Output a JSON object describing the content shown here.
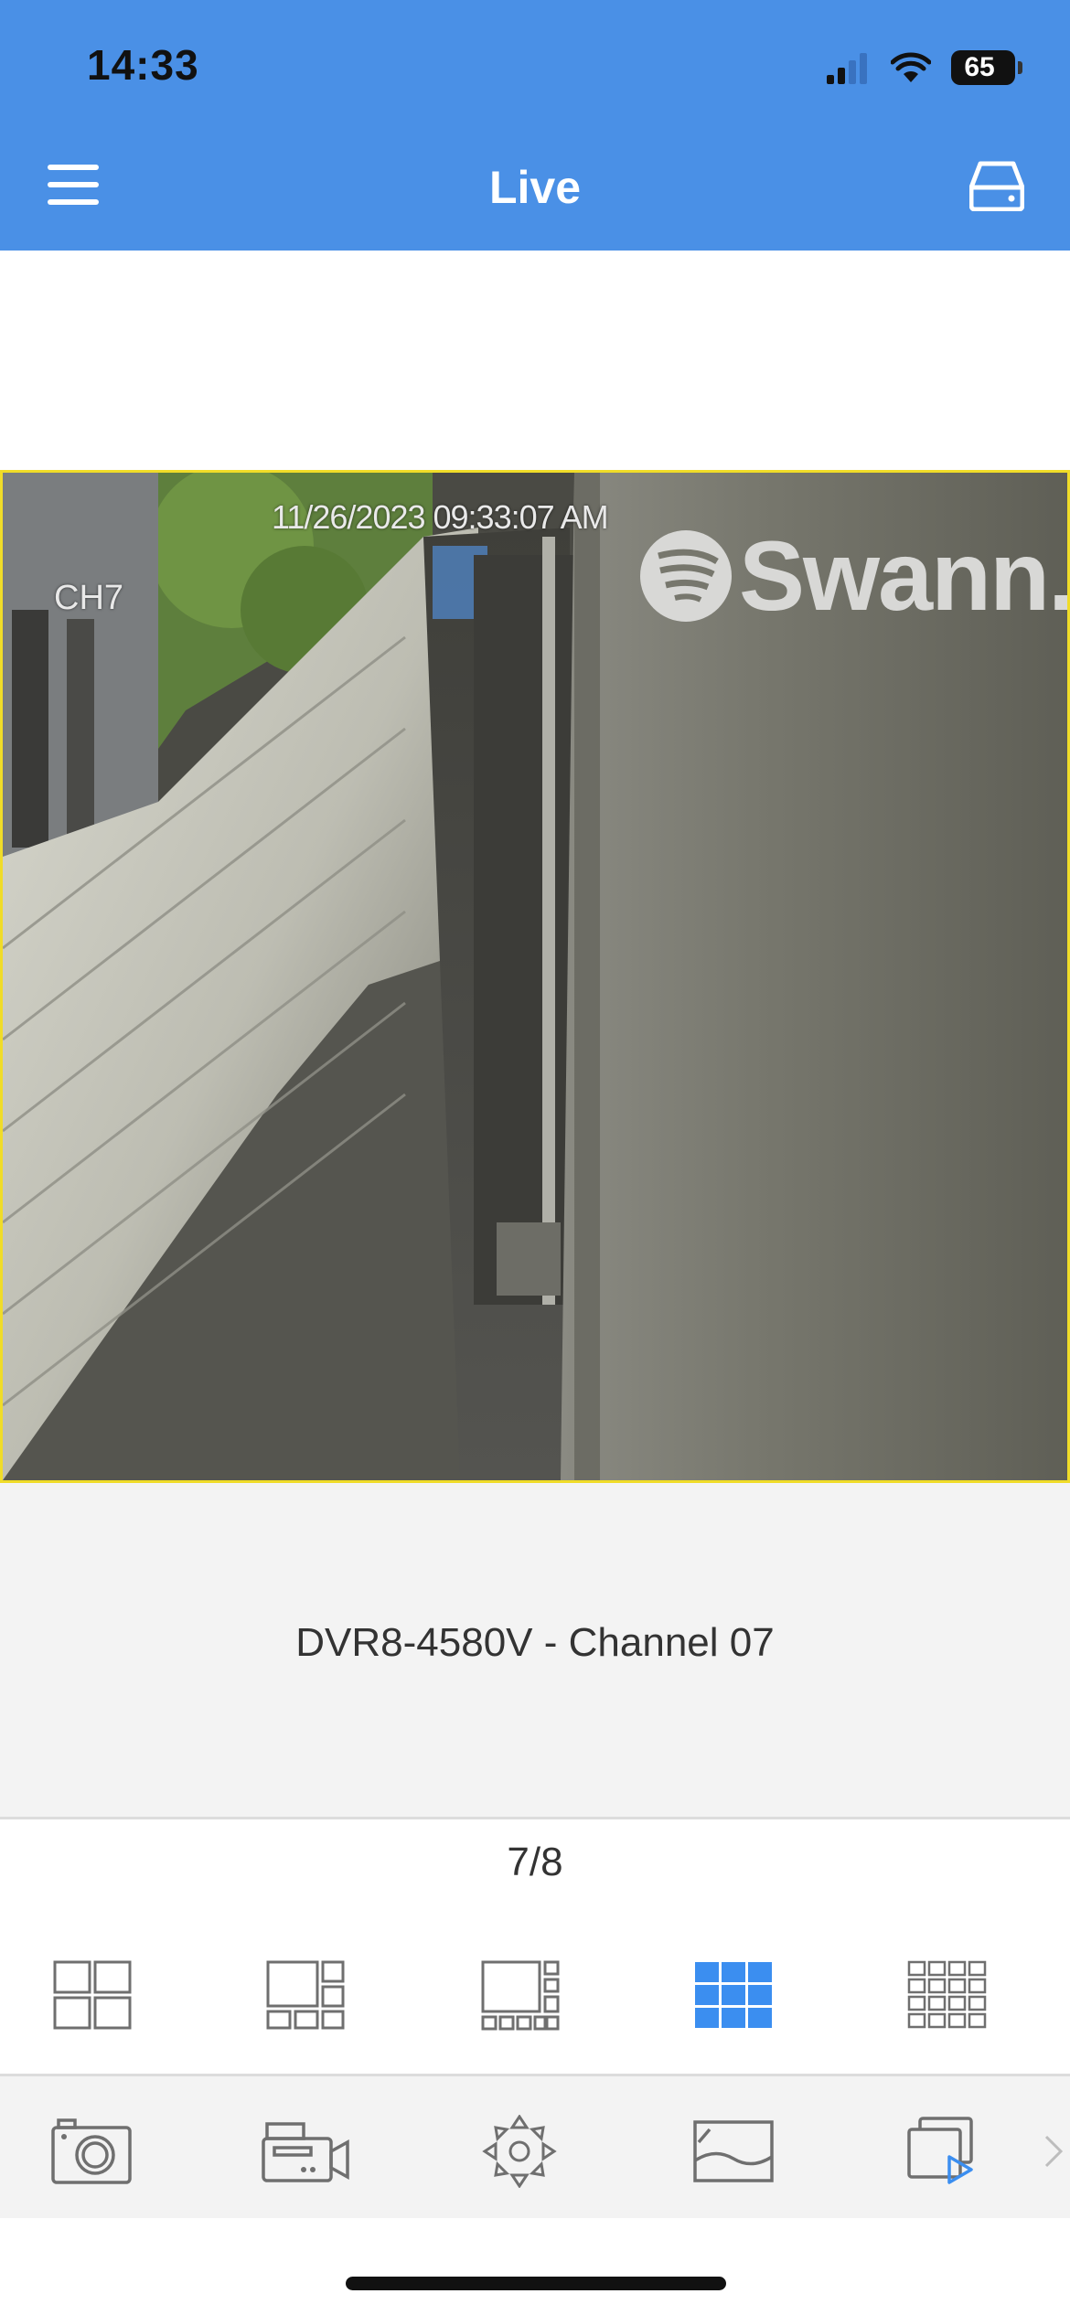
{
  "status_bar": {
    "time": "14:33",
    "battery_level": "65",
    "icons": [
      "cellular-signal-icon",
      "wifi-icon",
      "battery-icon"
    ]
  },
  "header": {
    "title": "Live",
    "menu_icon": "hamburger-menu-icon",
    "device_icon": "storage-device-icon",
    "background_color": "#4a90e6"
  },
  "video": {
    "timestamp": "11/26/2023 09:33:07 AM",
    "channel_overlay": "CH7",
    "watermark": "Swann.",
    "border_color": "#f0dc28"
  },
  "info": {
    "channel_name": "DVR8-4580V - Channel 07"
  },
  "pager": {
    "text": "7/8"
  },
  "layouts": {
    "accent_color": "#3b8ef0",
    "options": [
      {
        "name": "layout-4-grid",
        "selected": false
      },
      {
        "name": "layout-6-split",
        "selected": false
      },
      {
        "name": "layout-8-split",
        "selected": false
      },
      {
        "name": "layout-9-grid",
        "selected": true
      },
      {
        "name": "layout-16-grid",
        "selected": false
      }
    ]
  },
  "toolbar": {
    "items": [
      "snapshot-icon",
      "record-icon",
      "ptz-control-icon",
      "image-settings-icon",
      "playback-icon",
      "chevron-right-icon"
    ]
  }
}
